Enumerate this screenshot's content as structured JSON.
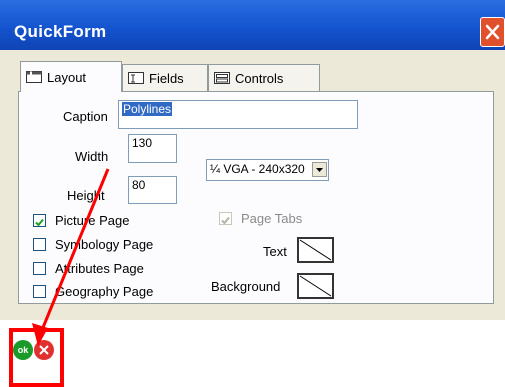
{
  "window": {
    "title": "QuickForm"
  },
  "tabs": [
    {
      "label": "Layout",
      "icon": "layout-icon",
      "active": true
    },
    {
      "label": "Fields",
      "icon": "fields-icon",
      "active": false
    },
    {
      "label": "Controls",
      "icon": "controls-icon",
      "active": false
    }
  ],
  "layout": {
    "caption_label": "Caption",
    "caption_value": "Polylines",
    "width_label": "Width",
    "width_value": "130",
    "height_label": "Height",
    "height_value": "80",
    "screen_size": "¼ VGA - 240x320",
    "checkboxes": [
      {
        "label": "Picture Page",
        "checked": true
      },
      {
        "label": "Symbology Page",
        "checked": false
      },
      {
        "label": "Attributes Page",
        "checked": false
      },
      {
        "label": "Geography Page",
        "checked": false
      }
    ],
    "page_tabs_label": "Page Tabs",
    "page_tabs_checked": true,
    "text_label": "Text",
    "background_label": "Background"
  },
  "footer": {
    "ok_label": "ok"
  },
  "colors": {
    "titlebar": "#1454d0",
    "panel": "#ece9d8",
    "highlight": "#ff0000",
    "ok": "#1a9a28",
    "cancel": "#e03030"
  }
}
